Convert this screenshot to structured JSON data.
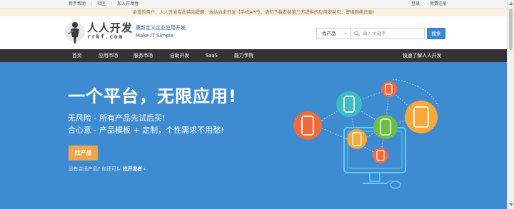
{
  "topbar": {
    "left_links": [
      "新手帮助",
      "社区",
      "加入开发者"
    ],
    "separator": "|",
    "right_links": [
      "登录",
      "免费注册"
    ]
  },
  "notice": "亲爱的用户，人人开发在此特别提醒：本站尚未开发【手机APP】，请勿下载安装第三方提供的应用安装包，警惕网络诈骗!",
  "header": {
    "brand_cn": "人人开发",
    "brand_en": "rrkf.com",
    "slogan_cn": "重新定义企业应用开发",
    "slogan_en": "Make  IT  Simple",
    "search": {
      "select_value": "找产品",
      "placeholder": "输入关键字",
      "button": "搜索"
    }
  },
  "nav": {
    "items": [
      "首页",
      "应用市场",
      "服务市场",
      "自助开发",
      "SaaS",
      "能力学院"
    ],
    "right": "快速了解人人开发"
  },
  "hero": {
    "title": "一个平台，无限应用!",
    "line1": "无风险  -  所有产品先试后买!",
    "line2": "合心意  -  产品模板 + 定制，个性需求不用愁!",
    "cta": "找产品",
    "sub_prefix": "没有合适产品? 你还可以 ",
    "sub_link": "找开发者",
    "sub_arrow": "›"
  },
  "colors": {
    "hero_bg": "#3f8bd2",
    "nav_bg": "#333333",
    "cta": "#f0a54a",
    "search_button": "#3a87d6",
    "notice_bg": "#fbf0e2"
  },
  "icons": {
    "logo": "person-silhouette-logo-icon",
    "search": "magnifier-icon",
    "dropdown": "chevron-down-icon"
  }
}
